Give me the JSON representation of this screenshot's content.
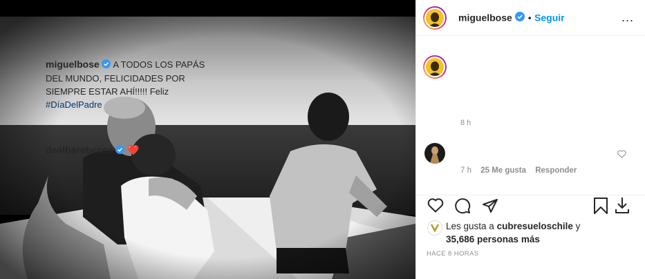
{
  "post": {
    "username": "miguelbose",
    "follow_separator": "•",
    "follow_label": "Seguir",
    "more_label": "...",
    "caption_text": "A TODOS LOS PAPÁS DEL MUNDO, FELICIDADES POR SIEMPRE ESTAR AHÍ!!!!! Feliz",
    "hashtag": "#DíaDelPadre",
    "caption_time": "8 h"
  },
  "comment": {
    "username": "dealbarebecca",
    "emoji": "❤️",
    "time": "7 h",
    "likes": "25 Me gusta",
    "reply_label": "Responder"
  },
  "likes": {
    "prefix": "Les gusta a",
    "liker": "cubresueloschile",
    "conjunction": "y",
    "others": "35,686 personas más"
  },
  "timestamp": "HACE 8 HORAS",
  "colors": {
    "accent": "#0095f6",
    "verified": "#3897f0",
    "heart": "#ed4956"
  }
}
